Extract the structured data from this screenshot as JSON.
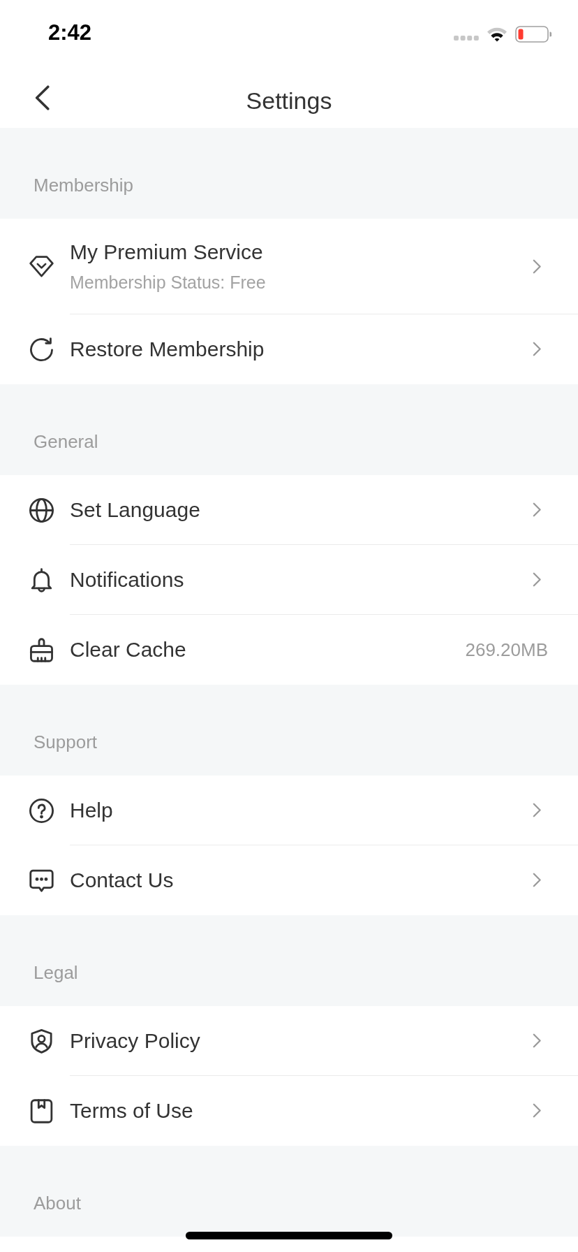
{
  "status_bar": {
    "time": "2:42"
  },
  "nav_bar": {
    "title": "Settings"
  },
  "sections": [
    {
      "title": "Membership",
      "items": [
        {
          "kind": "link",
          "label": "My Premium Service",
          "subtitle": "Membership Status: Free"
        },
        {
          "kind": "link",
          "label": "Restore Membership"
        }
      ]
    },
    {
      "title": "General",
      "items": [
        {
          "kind": "link",
          "label": "Set Language"
        },
        {
          "kind": "link",
          "label": "Notifications"
        },
        {
          "kind": "value",
          "label": "Clear Cache",
          "value": "269.20MB"
        }
      ]
    },
    {
      "title": "Support",
      "items": [
        {
          "kind": "link",
          "label": "Help"
        },
        {
          "kind": "link",
          "label": "Contact Us"
        }
      ]
    },
    {
      "title": "Legal",
      "items": [
        {
          "kind": "link",
          "label": "Privacy Policy"
        },
        {
          "kind": "link",
          "label": "Terms of Use"
        }
      ]
    },
    {
      "title": "About"
    }
  ]
}
